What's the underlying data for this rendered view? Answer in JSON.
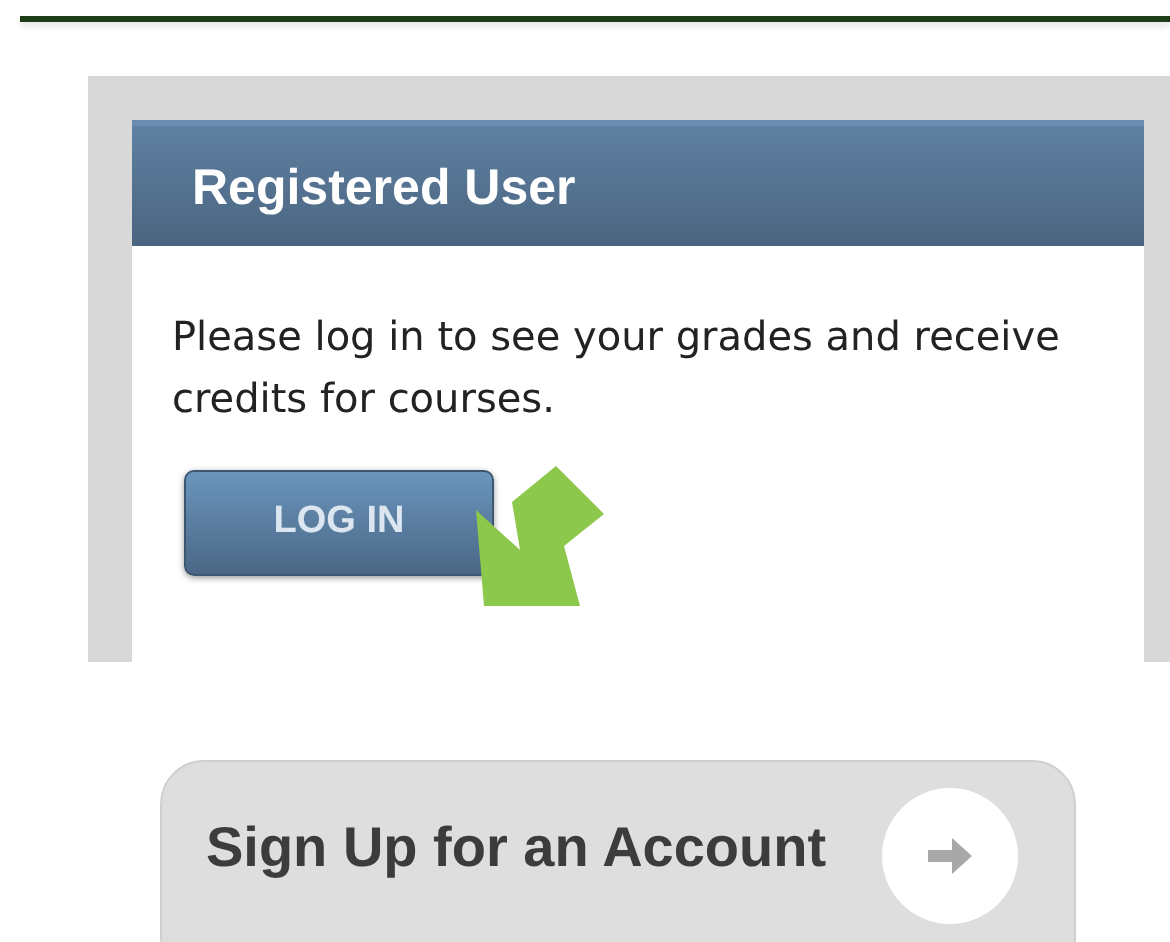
{
  "login_panel": {
    "title": "Registered User",
    "message": "Please log in to see your grades and receive credits for courses.",
    "button": "LOG IN"
  },
  "signup_button": {
    "label": "Sign Up for an Account"
  }
}
